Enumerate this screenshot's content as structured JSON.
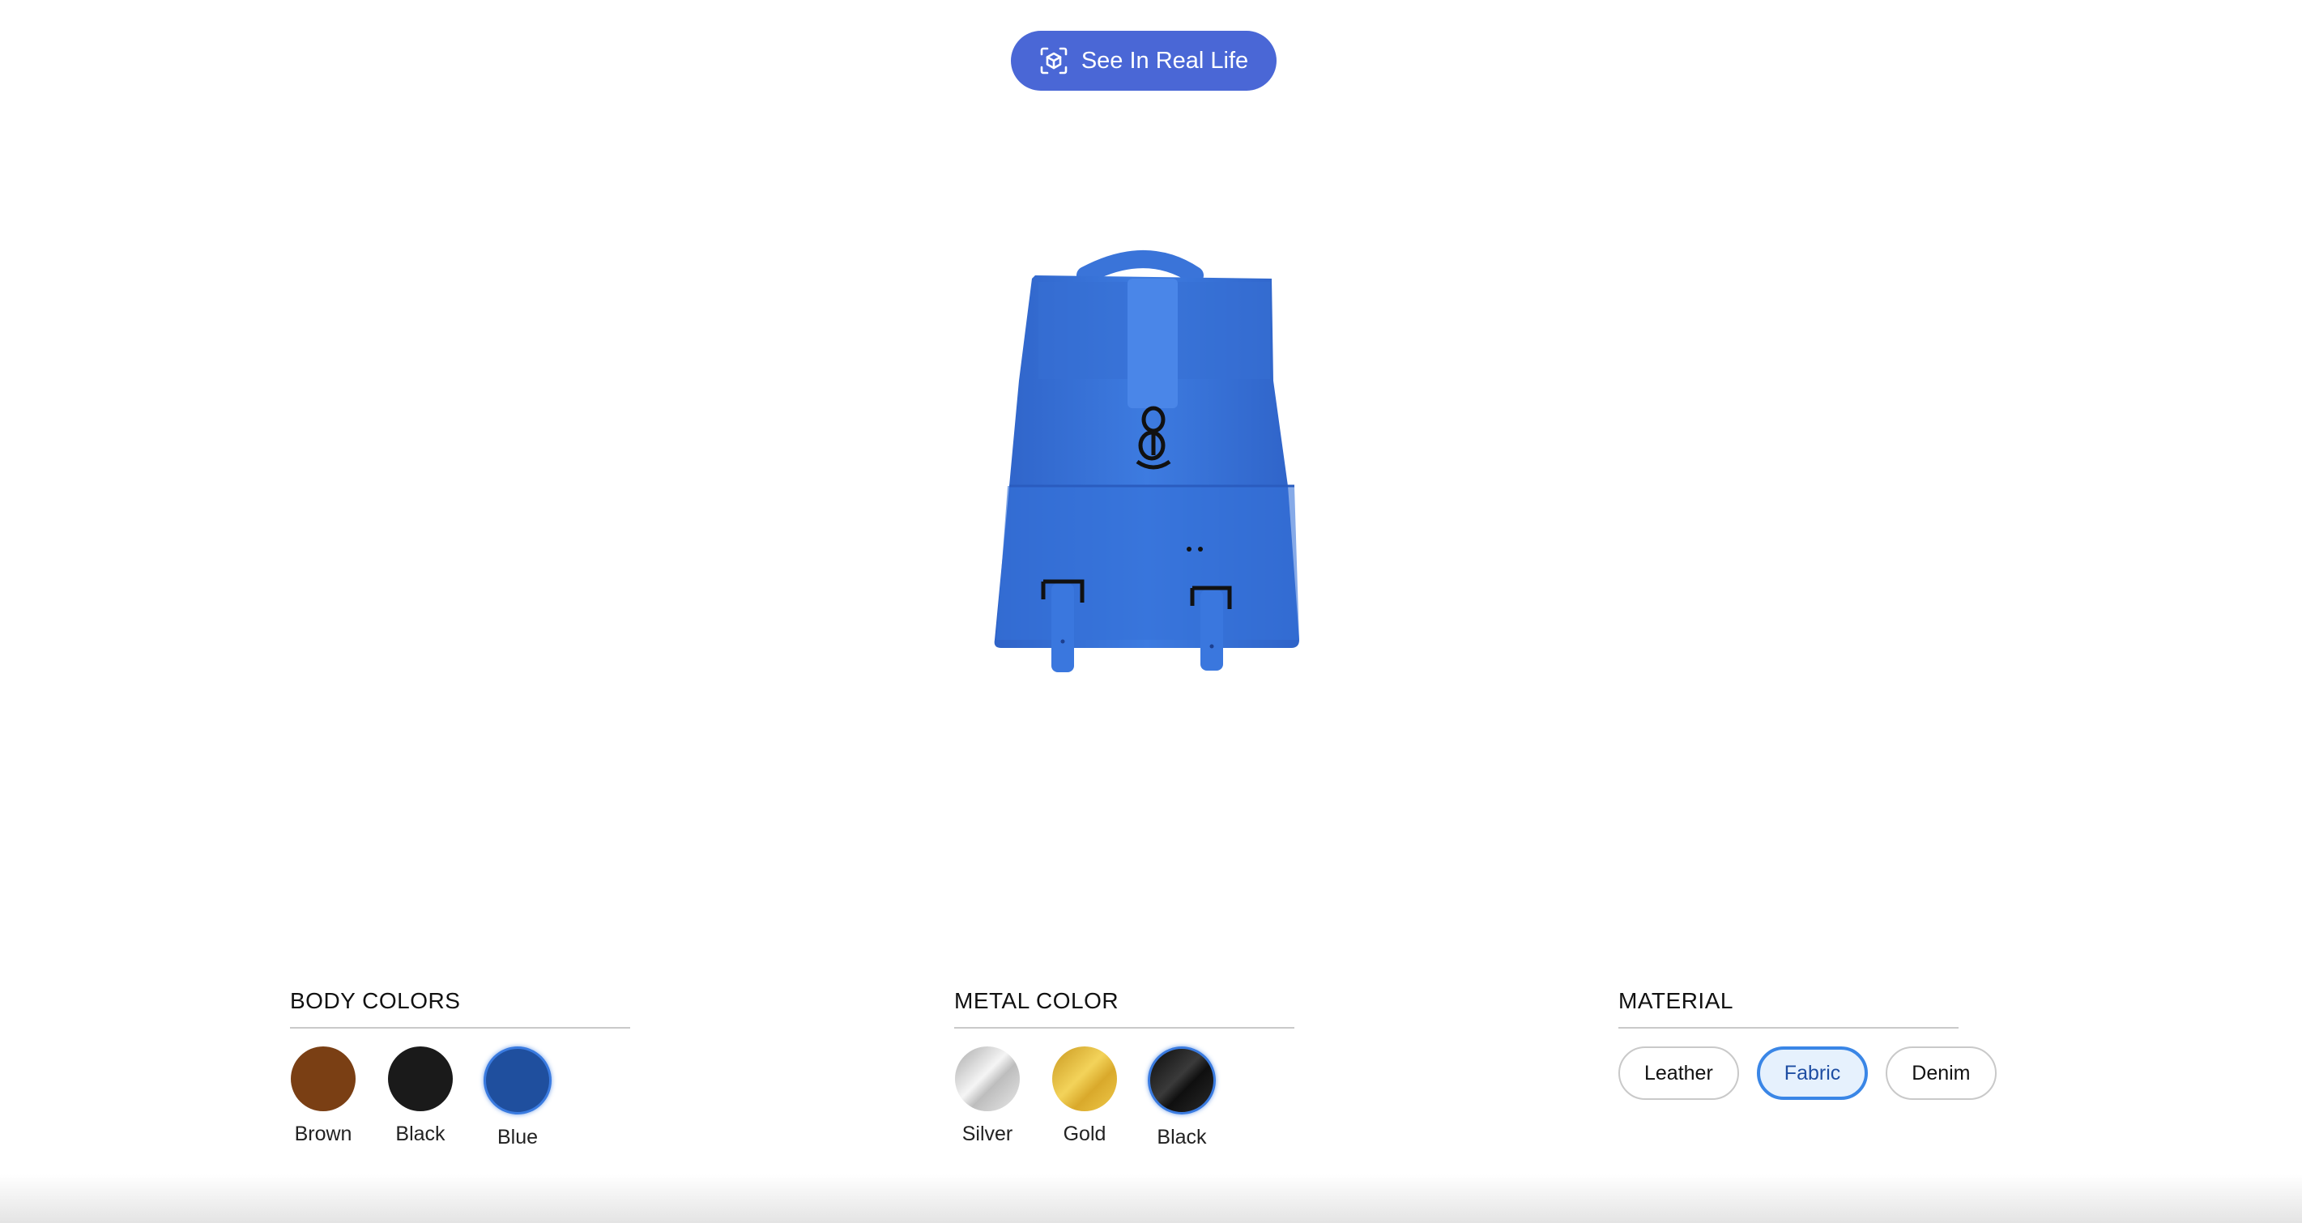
{
  "ar_button": {
    "label": "See In Real Life",
    "icon": "ar-cube-icon"
  },
  "model": {
    "product": "backpack",
    "body_color_hex": "#3a74d9",
    "metal_color_hex": "#1b1b1b"
  },
  "body_colors": {
    "title": "BODY COLORS",
    "options": [
      {
        "label": "Brown",
        "color": "#7a3f14",
        "selected": false
      },
      {
        "label": "Black",
        "color": "#1a1a1a",
        "selected": false
      },
      {
        "label": "Blue",
        "color": "#1f4f9e",
        "selected": true
      }
    ]
  },
  "metal_color": {
    "title": "METAL COLOR",
    "options": [
      {
        "label": "Silver",
        "color": "#d4d4d4",
        "selected": false
      },
      {
        "label": "Gold",
        "color": "#e1b93c",
        "selected": false
      },
      {
        "label": "Black",
        "color": "#161616",
        "selected": true
      }
    ]
  },
  "material": {
    "title": "MATERIAL",
    "options": [
      {
        "label": "Leather",
        "selected": false
      },
      {
        "label": "Fabric",
        "selected": true
      },
      {
        "label": "Denim",
        "selected": false
      }
    ]
  },
  "accent_color": "#4a67d6"
}
